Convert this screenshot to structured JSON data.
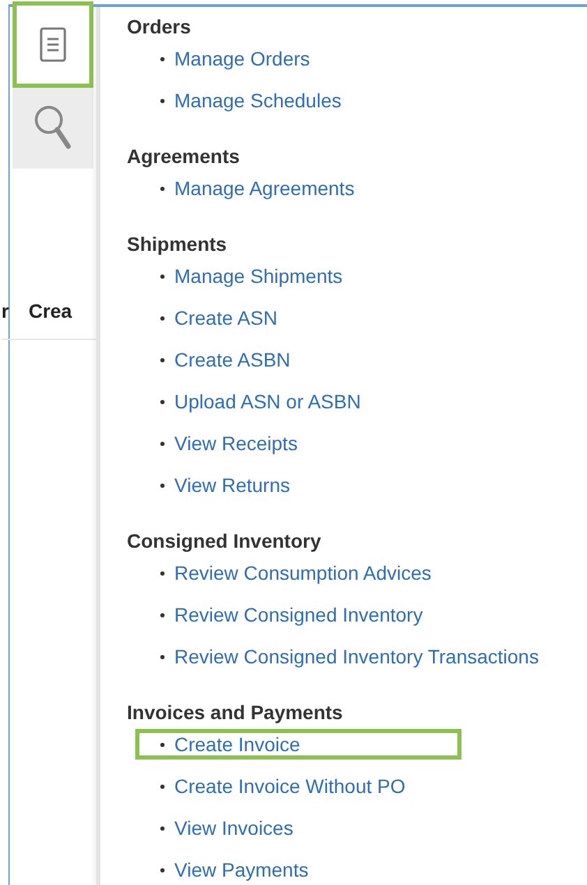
{
  "side_tabs": [
    {
      "kind": "tasks",
      "selected": true
    },
    {
      "kind": "search",
      "selected": false
    }
  ],
  "table_header": [
    "r",
    "Crea"
  ],
  "sections": [
    {
      "title": "Orders",
      "items": [
        {
          "label": "Manage Orders",
          "highlighted": false
        },
        {
          "label": "Manage Schedules",
          "highlighted": false
        }
      ]
    },
    {
      "title": "Agreements",
      "items": [
        {
          "label": "Manage Agreements",
          "highlighted": false
        }
      ]
    },
    {
      "title": "Shipments",
      "items": [
        {
          "label": "Manage Shipments",
          "highlighted": false
        },
        {
          "label": "Create ASN",
          "highlighted": false
        },
        {
          "label": "Create ASBN",
          "highlighted": false
        },
        {
          "label": "Upload ASN or ASBN",
          "highlighted": false
        },
        {
          "label": "View Receipts",
          "highlighted": false
        },
        {
          "label": "View Returns",
          "highlighted": false
        }
      ]
    },
    {
      "title": "Consigned Inventory",
      "items": [
        {
          "label": "Review Consumption Advices",
          "highlighted": false
        },
        {
          "label": "Review Consigned Inventory",
          "highlighted": false
        },
        {
          "label": "Review Consigned Inventory Transactions",
          "highlighted": false
        }
      ]
    },
    {
      "title": "Invoices and Payments",
      "items": [
        {
          "label": "Create Invoice",
          "highlighted": true
        },
        {
          "label": "Create Invoice Without PO",
          "highlighted": false
        },
        {
          "label": "View Invoices",
          "highlighted": false
        },
        {
          "label": "View Payments",
          "highlighted": false
        }
      ]
    }
  ]
}
